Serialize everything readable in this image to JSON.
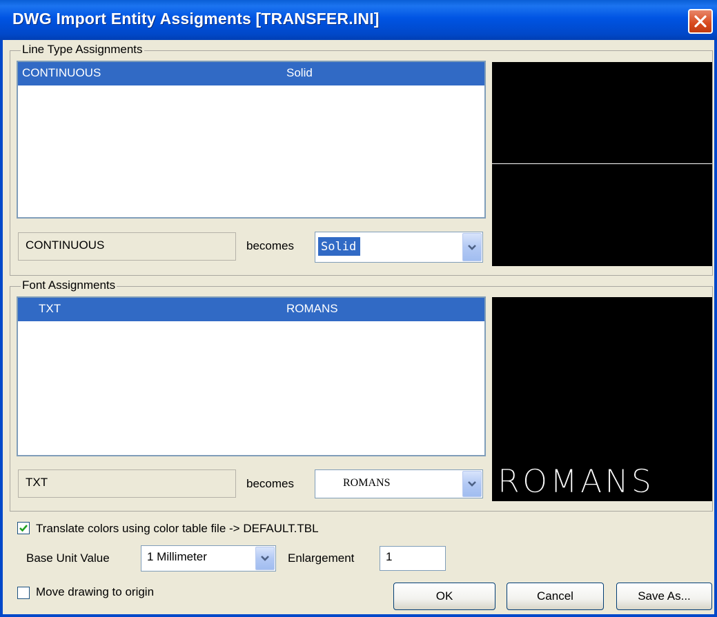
{
  "window": {
    "title": "DWG Import Entity Assigments [TRANSFER.INI]"
  },
  "line_type": {
    "group_label": "Line Type Assignments",
    "rows": [
      {
        "source": "CONTINUOUS",
        "target": "Solid"
      }
    ],
    "current_source": "CONTINUOUS",
    "becomes_label": "becomes",
    "selected_value": "Solid"
  },
  "font": {
    "group_label": "Font Assignments",
    "rows": [
      {
        "source": "TXT",
        "target": "ROMANS"
      }
    ],
    "current_source": "TXT",
    "becomes_label": "becomes",
    "selected_value": "ROMANS",
    "preview_text": "ROMANS"
  },
  "options": {
    "translate_colors_label": "Translate colors using color table file  -> DEFAULT.TBL",
    "translate_colors_checked": true,
    "base_unit_label": "Base Unit Value",
    "base_unit_value": "1 Millimeter",
    "enlargement_label": "Enlargement",
    "enlargement_value": "1",
    "move_to_origin_label": "Move drawing to origin",
    "move_to_origin_checked": false
  },
  "buttons": {
    "ok": "OK",
    "cancel": "Cancel",
    "save_as": "Save As..."
  },
  "icons": {
    "close": "close-icon",
    "dropdown": "chevron-down-icon",
    "check": "checkmark-icon"
  },
  "colors": {
    "title_bar": "#0054e3",
    "selection": "#316ac5",
    "close_button": "#d84a1e",
    "dialog_bg": "#ece9d8",
    "preview_bg": "#000000"
  }
}
